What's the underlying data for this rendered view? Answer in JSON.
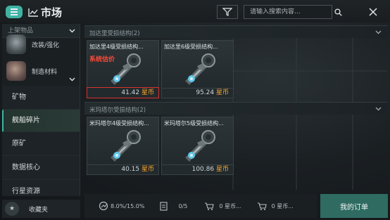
{
  "header": {
    "title": "市场",
    "search_placeholder": "请输入搜索内容..."
  },
  "sidebar": {
    "header_label": "上架物品",
    "categories": [
      {
        "label": "改装/强化"
      },
      {
        "label": "制造材料"
      }
    ],
    "items": [
      {
        "label": "矿物"
      },
      {
        "label": "舰船碎片"
      },
      {
        "label": "原矿"
      },
      {
        "label": "数据核心"
      },
      {
        "label": "行星资源"
      }
    ],
    "favorites_label": "收藏夹"
  },
  "groups": [
    {
      "title": "加达里受损结构(2)",
      "items": [
        {
          "name": "加达里4级受损结构...",
          "price": "41.42",
          "currency": "星币",
          "tag": "系统估价"
        },
        {
          "name": "加达里6级受损结构...",
          "price": "95.24",
          "currency": "星币"
        }
      ]
    },
    {
      "title": "米玛塔尔受损结构(2)",
      "items": [
        {
          "name": "米玛塔尔4级受损结构...",
          "price": "40.15",
          "currency": "星币"
        },
        {
          "name": "米玛塔尔5级受损结构...",
          "price": "100.86",
          "currency": "星币"
        }
      ]
    }
  ],
  "bottom": {
    "tax": "8.0%/15.0%",
    "orders_count": "0/5",
    "buy_total": "0 星币...",
    "sell_total": "0 星币...",
    "my_orders_label": "我的订单"
  },
  "colors": {
    "accent": "#3fb4a2",
    "currency": "#ffa72c",
    "alert": "#d7322f"
  }
}
